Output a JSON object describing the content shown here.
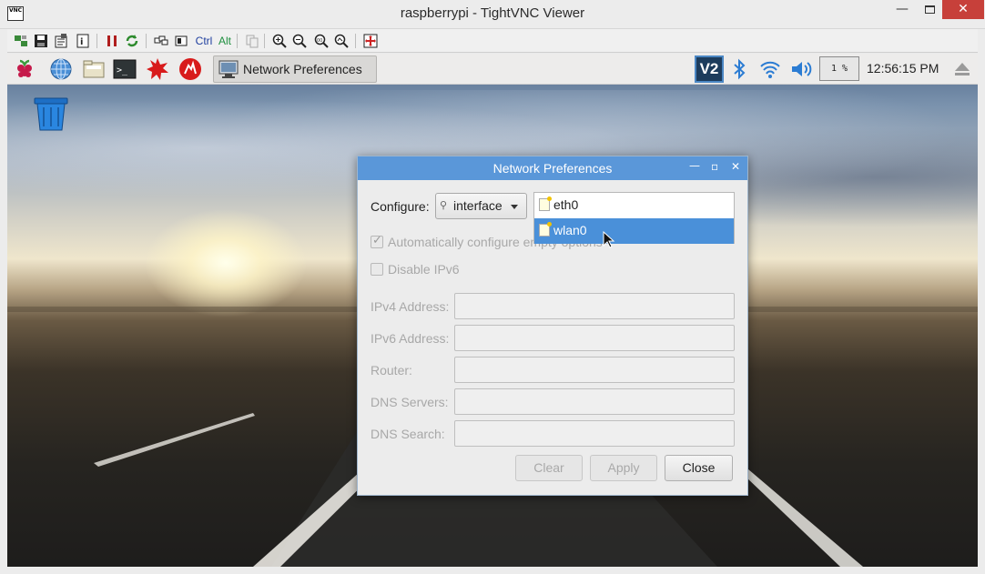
{
  "window": {
    "title": "raspberrypi - TightVNC Viewer",
    "app_icon_text": "VNC",
    "minimize": "—",
    "close": "✕"
  },
  "vnc_toolbar": {
    "ctrl_label": "Ctrl",
    "alt_label": "Alt",
    "buttons": [
      "new-connection",
      "save",
      "options",
      "info",
      "pause",
      "refresh",
      "ctrl-alt-del",
      "ctrl",
      "alt",
      "clipboard",
      "zoom-in",
      "zoom-out",
      "zoom-100",
      "zoom-auto",
      "fullscreen"
    ]
  },
  "taskbar": {
    "launchers": [
      "raspberry-menu",
      "web-browser",
      "file-manager",
      "terminal",
      "mathematica",
      "wolfram"
    ],
    "active_task": "Network Preferences",
    "tray": {
      "vnc_label": "V2",
      "cpu": "1 %",
      "clock": "12:56:15 PM"
    }
  },
  "dialog": {
    "title": "Network Preferences",
    "minimize": "—",
    "maximize": "▫",
    "close": "✕",
    "configure_label": "Configure:",
    "configure_value": "interface",
    "interfaces": [
      {
        "label": "eth0",
        "selected": false
      },
      {
        "label": "wlan0",
        "selected": true
      }
    ],
    "auto_config_label": "Automatically configure empty options",
    "auto_config_checked": true,
    "disable_ipv6_label": "Disable IPv6",
    "disable_ipv6_checked": false,
    "fields": [
      {
        "label": "IPv4 Address:",
        "value": ""
      },
      {
        "label": "IPv6 Address:",
        "value": ""
      },
      {
        "label": "Router:",
        "value": ""
      },
      {
        "label": "DNS Servers:",
        "value": ""
      },
      {
        "label": "DNS Search:",
        "value": ""
      }
    ],
    "buttons": {
      "clear": "Clear",
      "apply": "Apply",
      "close": "Close"
    }
  },
  "colors": {
    "dialog_title": "#5a97d9",
    "selection": "#4a90d9",
    "win_close": "#c7403a"
  }
}
